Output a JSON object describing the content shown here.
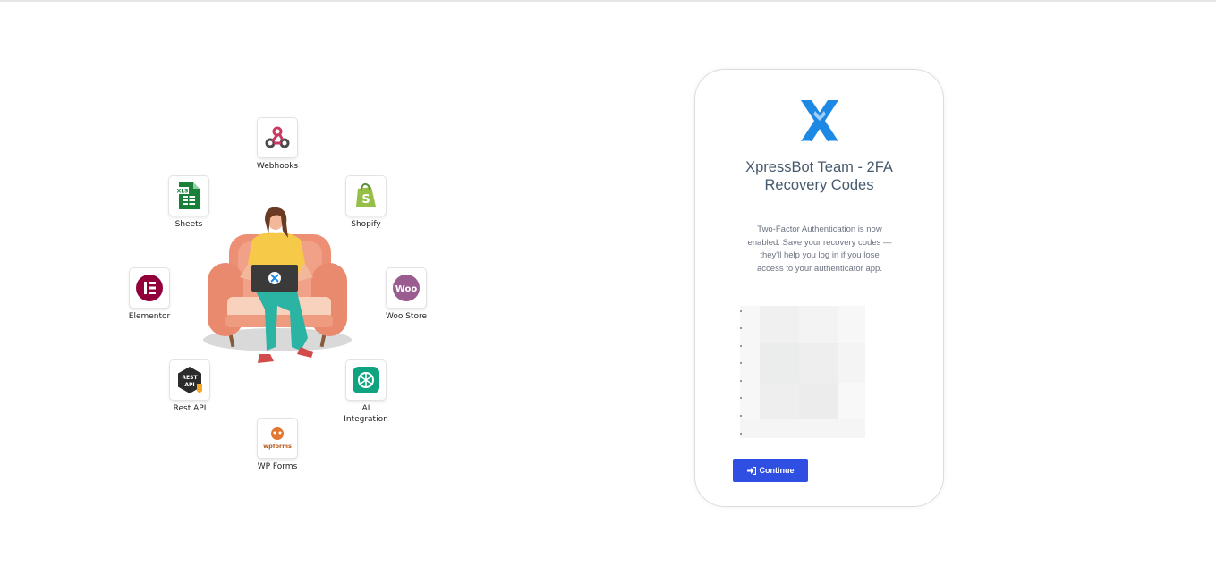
{
  "integrations": [
    {
      "label": "Webhooks",
      "icon": "webhook-icon"
    },
    {
      "label": "Shopify",
      "icon": "shopify-icon"
    },
    {
      "label": "Woo Store",
      "icon": "woocommerce-icon"
    },
    {
      "label": "AI Integration",
      "icon": "openai-icon"
    },
    {
      "label": "WP Forms",
      "icon": "wpforms-icon"
    },
    {
      "label": "Rest API",
      "icon": "rest-api-icon"
    },
    {
      "label": "Elementor",
      "icon": "elementor-icon"
    },
    {
      "label": "Sheets",
      "icon": "sheets-icon"
    }
  ],
  "badges": {
    "sheets_text": "XLS",
    "woo_text": "Woo",
    "rest_text_1": "REST",
    "rest_text_2": "API",
    "wpforms_text": "wpforms"
  },
  "card": {
    "logo": "xpressbot-logo",
    "title": "XpressBot Team - 2FA Recovery Codes",
    "description": "Two-Factor Authentication is now enabled. Save your recovery codes — they'll help you log in if you lose access to your authenticator app.",
    "recovery_codes_state": "blurred",
    "continue_label": "Continue",
    "continue_icon": "sign-in-icon"
  },
  "colors": {
    "brand_blue": "#1e88e5",
    "button": "#2f4fe3",
    "title": "#465a6e"
  }
}
